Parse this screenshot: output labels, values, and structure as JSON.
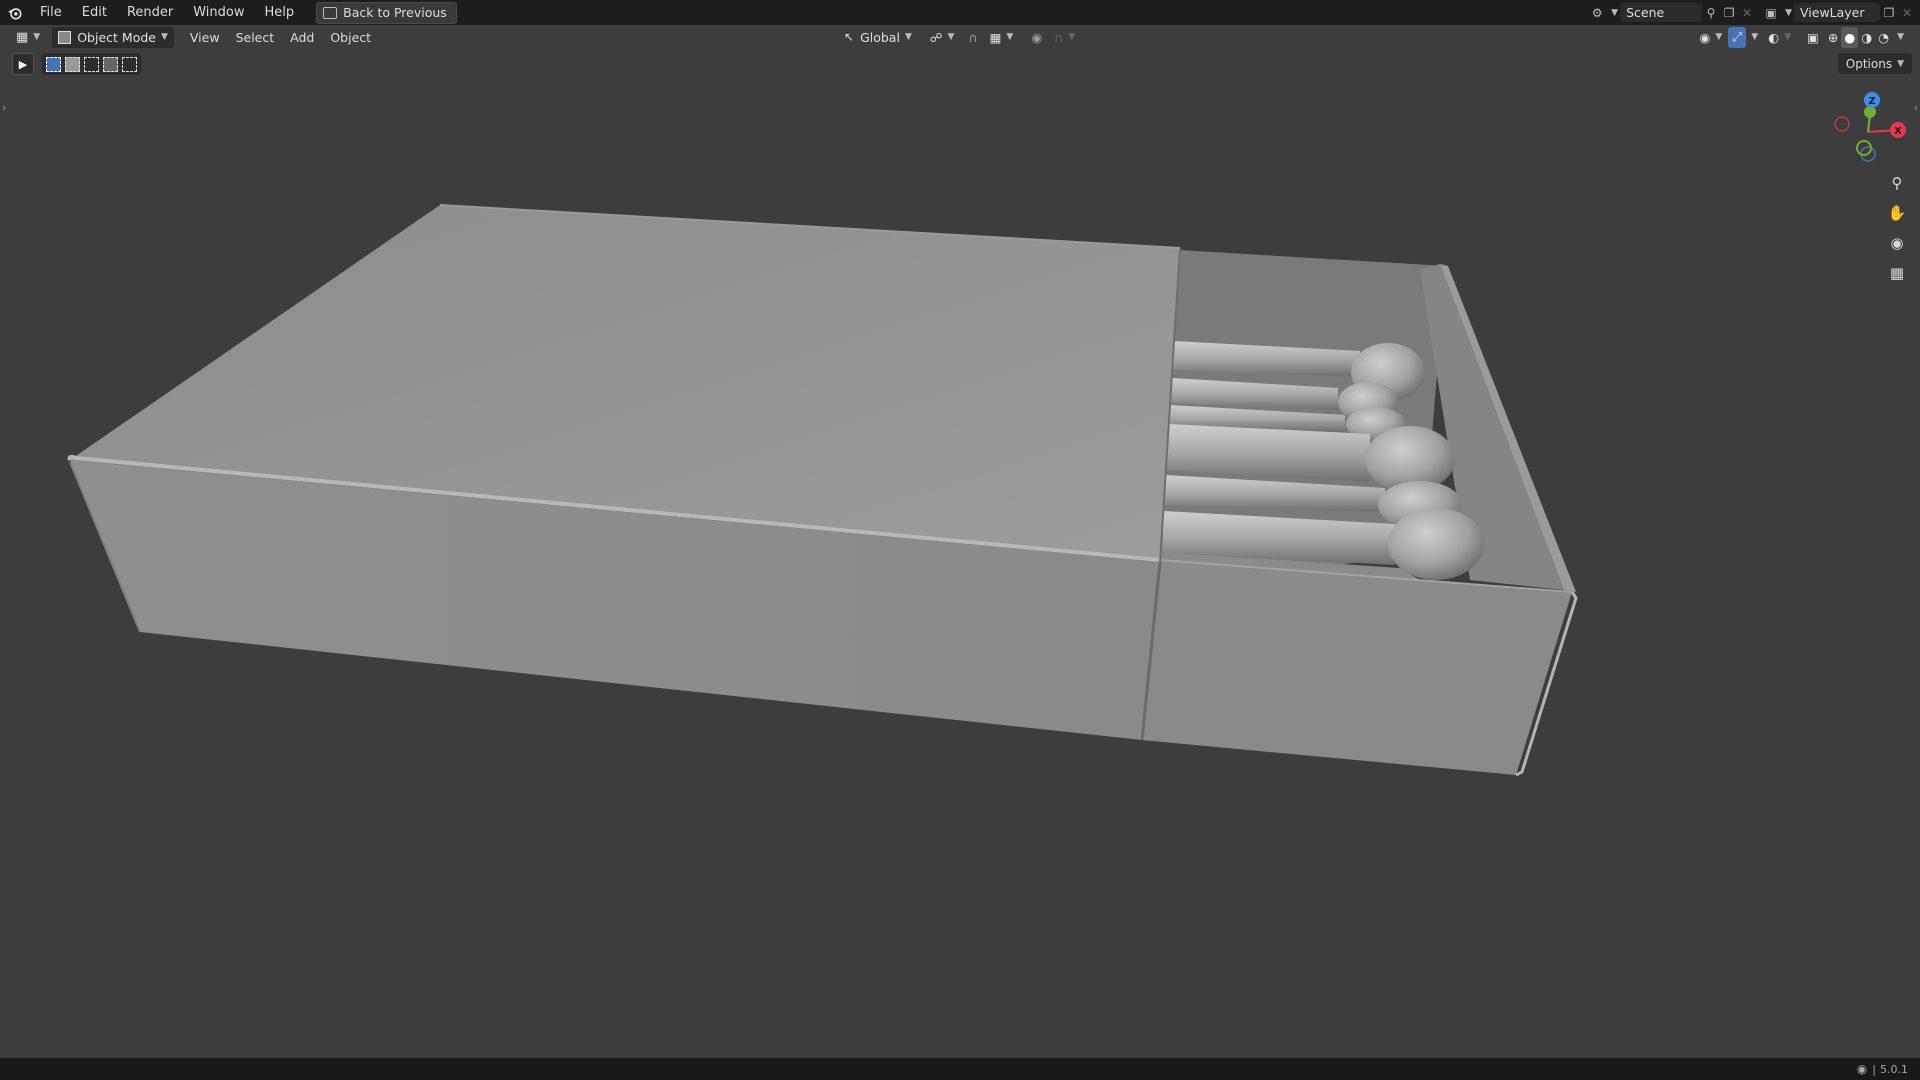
{
  "topbar": {
    "menus": [
      "File",
      "Edit",
      "Render",
      "Window",
      "Help"
    ],
    "back_label": "Back to Previous",
    "scene_label": "Scene",
    "viewlayer_label": "ViewLayer"
  },
  "header": {
    "mode_label": "Object Mode",
    "menus": [
      "View",
      "Select",
      "Add",
      "Object"
    ],
    "transform_orientation": "Global"
  },
  "toolbar": {
    "options_label": "Options"
  },
  "gizmo": {
    "z": "Z",
    "x": "X",
    "colors": {
      "x": "#e5394f",
      "y": "#76ad2b",
      "z": "#3d8ee8"
    }
  },
  "status": {
    "version": "5.0.1"
  }
}
